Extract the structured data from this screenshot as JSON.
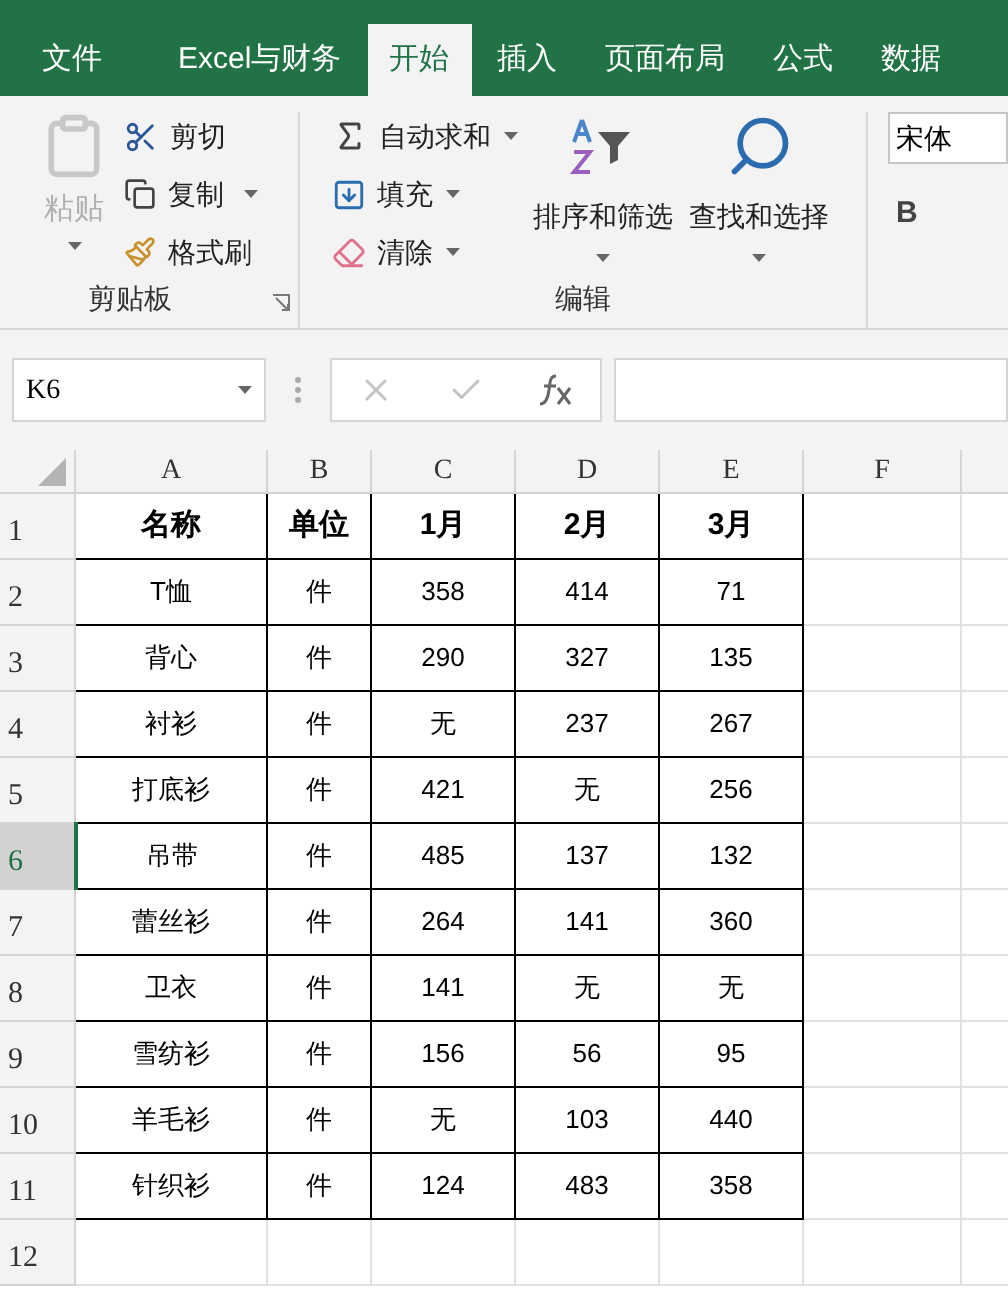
{
  "tabs": [
    {
      "label": "文件",
      "selected": false
    },
    {
      "label": "Excel与财务",
      "selected": false
    },
    {
      "label": "开始",
      "selected": true
    },
    {
      "label": "插入",
      "selected": false
    },
    {
      "label": "页面布局",
      "selected": false
    },
    {
      "label": "公式",
      "selected": false
    },
    {
      "label": "数据",
      "selected": false
    }
  ],
  "clipboard": {
    "paste": {
      "label": "粘贴",
      "disabled": true
    },
    "items": [
      {
        "kind": "cut",
        "label": "剪切",
        "dropdown": false
      },
      {
        "kind": "copy",
        "label": "复制",
        "dropdown": true
      },
      {
        "kind": "painter",
        "label": "格式刷",
        "dropdown": false
      }
    ],
    "group_label": "剪贴板"
  },
  "editing": {
    "items": [
      {
        "kind": "sum",
        "label": "自动求和"
      },
      {
        "kind": "fill",
        "label": "填充"
      },
      {
        "kind": "clear",
        "label": "清除"
      }
    ],
    "big": [
      {
        "kind": "sort",
        "label": "排序和筛选"
      },
      {
        "kind": "find",
        "label": "查找和选择"
      }
    ],
    "group_label": "编辑"
  },
  "font": {
    "name": "宋体",
    "bold": "B"
  },
  "name_box": "K6",
  "columns": [
    {
      "label": "A",
      "selected": false
    },
    {
      "label": "B",
      "selected": false
    },
    {
      "label": "C",
      "selected": false
    },
    {
      "label": "D",
      "selected": false
    },
    {
      "label": "E",
      "selected": false
    },
    {
      "label": "F",
      "selected": false
    }
  ],
  "rows": [
    {
      "num": "1",
      "selected": false,
      "cells": [
        "名称",
        "单位",
        "1月",
        "2月",
        "3月"
      ]
    },
    {
      "num": "2",
      "selected": false,
      "cells": [
        "T恤",
        "件",
        "358",
        "414",
        "71"
      ]
    },
    {
      "num": "3",
      "selected": false,
      "cells": [
        "背心",
        "件",
        "290",
        "327",
        "135"
      ]
    },
    {
      "num": "4",
      "selected": false,
      "cells": [
        "衬衫",
        "件",
        "无",
        "237",
        "267"
      ]
    },
    {
      "num": "5",
      "selected": false,
      "cells": [
        "打底衫",
        "件",
        "421",
        "无",
        "256"
      ]
    },
    {
      "num": "6",
      "selected": true,
      "cells": [
        "吊带",
        "件",
        "485",
        "137",
        "132"
      ]
    },
    {
      "num": "7",
      "selected": false,
      "cells": [
        "蕾丝衫",
        "件",
        "264",
        "141",
        "360"
      ]
    },
    {
      "num": "8",
      "selected": false,
      "cells": [
        "卫衣",
        "件",
        "141",
        "无",
        "无"
      ]
    },
    {
      "num": "9",
      "selected": false,
      "cells": [
        "雪纺衫",
        "件",
        "156",
        "56",
        "95"
      ]
    },
    {
      "num": "10",
      "selected": false,
      "cells": [
        "羊毛衫",
        "件",
        "无",
        "103",
        "440"
      ]
    },
    {
      "num": "11",
      "selected": false,
      "cells": [
        "针织衫",
        "件",
        "124",
        "483",
        "358"
      ]
    },
    {
      "num": "12",
      "selected": false,
      "cells": []
    }
  ]
}
